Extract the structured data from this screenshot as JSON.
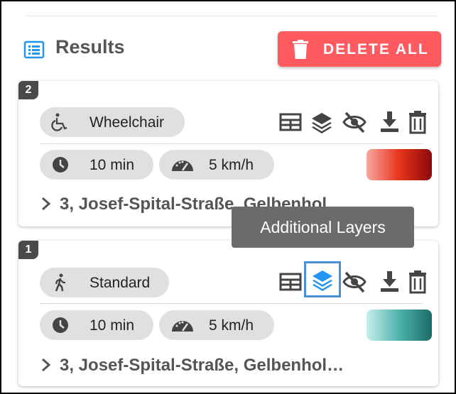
{
  "header": {
    "title": "Results",
    "delete_all_label": "DELETE ALL"
  },
  "colors": {
    "accent_blue": "#2196f3",
    "delete_red": "#ff5a5f",
    "highlight_blue": "#4a90d9"
  },
  "results": [
    {
      "number": "2",
      "profile": "Wheelchair",
      "profile_icon": "wheelchair-icon",
      "time": "10 min",
      "speed": "5 km/h",
      "address": "3, Josef-Spital-Straße, Gelbenhol…",
      "color_scheme": [
        "#f8a6a0",
        "#e8341c",
        "#8b0a0a"
      ]
    },
    {
      "number": "1",
      "profile": "Standard",
      "profile_icon": "walking-person-icon",
      "time": "10 min",
      "speed": "5 km/h",
      "address": "3, Josef-Spital-Straße, Gelbenhol…",
      "color_scheme": [
        "#c8eeeb",
        "#4db3ac",
        "#1c6b68"
      ],
      "highlighted_action": "layers-icon"
    }
  ],
  "actions": [
    "table-icon",
    "layers-icon",
    "visibility-off-icon",
    "download-icon",
    "trash-icon"
  ],
  "tooltip": {
    "text": "Additional Layers"
  }
}
